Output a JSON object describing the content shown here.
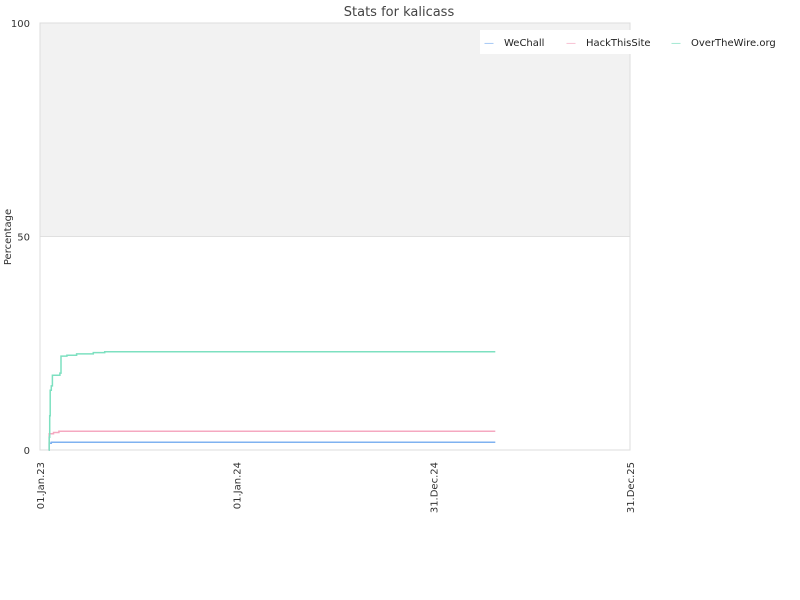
{
  "chart_data": {
    "type": "line",
    "title": "Stats for kalicass",
    "xlabel": "",
    "ylabel": "Percentage",
    "x_tick_labels": [
      "01.Jan.23",
      "01.Jan.24",
      "31.Dec.24",
      "31.Dec.25"
    ],
    "y_tick_labels": [
      "100",
      "50",
      "0"
    ],
    "xlim": [
      "2023-01-01",
      "2025-12-31"
    ],
    "ylim": [
      0,
      100
    ],
    "grid": "horizontal band: 50–100 shaded light gray",
    "legend_position": "top-right",
    "series": [
      {
        "name": "WeChall",
        "color": "#7fb2f0",
        "points": [
          [
            "2023-01-17",
            0
          ],
          [
            "2023-01-18",
            1.6
          ],
          [
            "2023-01-22",
            1.8
          ],
          [
            "2025-04-25",
            1.8
          ]
        ]
      },
      {
        "name": "HackThisSite",
        "color": "#f5a8c0",
        "points": [
          [
            "2023-01-17",
            0
          ],
          [
            "2023-01-18",
            3.8
          ],
          [
            "2023-01-26",
            4.1
          ],
          [
            "2023-02-05",
            4.4
          ],
          [
            "2025-04-25",
            4.4
          ]
        ]
      },
      {
        "name": "OverTheWire.org",
        "color": "#7de0c0",
        "points": [
          [
            "2023-01-17",
            0
          ],
          [
            "2023-01-18",
            3
          ],
          [
            "2023-01-19",
            8
          ],
          [
            "2023-01-20",
            14
          ],
          [
            "2023-01-22",
            15
          ],
          [
            "2023-01-24",
            17.5
          ],
          [
            "2023-02-07",
            18
          ],
          [
            "2023-02-09",
            22
          ],
          [
            "2023-02-20",
            22.2
          ],
          [
            "2023-03-10",
            22.5
          ],
          [
            "2023-04-10",
            22.8
          ],
          [
            "2023-05-01",
            23
          ],
          [
            "2025-04-25",
            23
          ]
        ]
      }
    ],
    "legend_marker": "—"
  }
}
